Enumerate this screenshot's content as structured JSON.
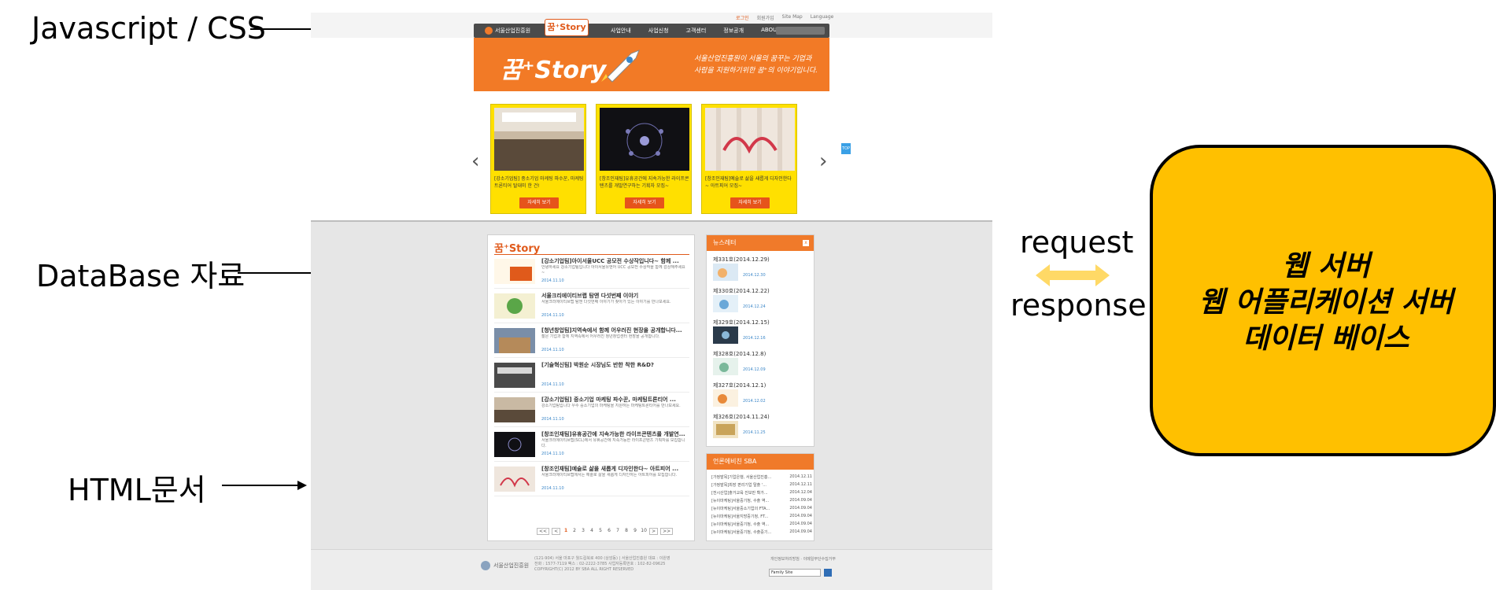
{
  "labels": {
    "javascript_css": "Javascript / CSS",
    "database": "DataBase 자료",
    "html_doc": "HTML문서"
  },
  "connection": {
    "request": "request",
    "response": "response",
    "arrow_color": "#ffd966"
  },
  "server": {
    "line1": "웹 서버",
    "line2": "웹 어플리케이션 서버",
    "line3": "데이터 베이스",
    "fill_color": "#ffc000"
  },
  "site": {
    "util": [
      "로그인",
      "회원가입",
      "Site Map",
      "Language"
    ],
    "gnb": {
      "logo": "서울산업진흥원",
      "story_tab": "꿈⁺Story",
      "menu": [
        "사업안내",
        "사업신청",
        "고객센터",
        "정보공개",
        "ABOUT SBA"
      ]
    },
    "banner": {
      "title": "꿈⁺Story",
      "slogan": "서울산업진흥원이 서울의 꿈꾸는 기업과 사람을 지원하기위한 꿈⁺의 이야기입니다."
    },
    "cards": [
      {
        "caption": "[강소기업팀] 중소기업 마케팅 파수꾼, 마케팅 트론티어 탈대미 한 건!",
        "more": "자세히 보기"
      },
      {
        "caption": "[창조인재팀]유휴공간에 지속가능한 라이프콘텐츠를 개발연구하는 기획자 모집~",
        "more": "자세히 보기"
      },
      {
        "caption": "[창조인재팀]예술로 삶을 새롭게 디자인한다~ 아트피어 모집~",
        "more": "자세히 보기"
      }
    ],
    "top_btn": "TOP",
    "main_panel": {
      "title": "꿈⁺Story",
      "items": [
        {
          "title": "[강소기업팀]아이서울UCC 공모전 수상작입니다~ 함께 ...",
          "desc": "안녕하세요 강소기업팀입니다 아이서울유앤어 UCC 공모전 수상작을 함께 감상해주세요~",
          "date": "2014.11.10"
        },
        {
          "title": "서울크리에이티브랩 탐앤 다섯번째 이야기",
          "desc": "서울크리에이티브랩 탐앤 다섯번째 이야기가 찾아가 있는 이야기를 만나보세요.",
          "date": "2014.11.10"
        },
        {
          "title": "[청년창업팀]지역속에서 함께 어우러진 현장을 공개합니다...",
          "desc": "젊은 기업과 함께 지역속에서 어우러진 청년창업센터 현장을 공개합니다.",
          "date": "2014.11.10"
        },
        {
          "title": "[기술혁신팀] 박원순 시장님도 반한 착한 R&D?",
          "desc": "",
          "date": "2014.11.10"
        },
        {
          "title": "[강소기업팀] 중소기업 마케팅 파수꾼, 마케팅트론티어 ...",
          "desc": "강소기업팀입니다 우수 중소기업의 마케팅을 지원하는 마케팅트론티어를 만나보세요.",
          "date": "2014.11.10"
        },
        {
          "title": "[창조인재팀]유휴공간에 지속가능한 라이프콘텐츠를 개발연...",
          "desc": "서울크리에이티브랩(SCL)에서 유휴공간에 지속가능한 라이프콘텐츠 기획자를 모집합니다.",
          "date": "2014.11.10"
        },
        {
          "title": "[창조인재팀]예술로 삶을 새롭게 디자인한다~ 아트피어 ...",
          "desc": "서울크리에이티브랩에서는 예술로 삶을 새롭게 디자인하는 아트피어를 모집합니다.",
          "date": "2014.11.10"
        }
      ],
      "pager": [
        "<<",
        "<",
        "1",
        "2",
        "3",
        "4",
        "5",
        "6",
        "7",
        "8",
        "9",
        "10",
        ">",
        ">>"
      ]
    },
    "newsletter": {
      "title": "뉴스레터",
      "close": "x",
      "items": [
        {
          "title": "제331호(2014.12.29)",
          "date": "2014.12.30"
        },
        {
          "title": "제330호(2014.12.22)",
          "date": "2014.12.24"
        },
        {
          "title": "제329호(2014.12.15)",
          "date": "2014.12.16"
        },
        {
          "title": "제328호(2014.12.8)",
          "date": "2014.12.09"
        },
        {
          "title": "제327호(2014.12.1)",
          "date": "2014.12.02"
        },
        {
          "title": "제326호(2014.11.24)",
          "date": "2014.11.25"
        }
      ]
    },
    "press": {
      "title": "언론에비친 SBA",
      "items": [
        {
          "t": "[가정발목]기업은행, 서울산업진흥...",
          "d": "2014.12.11"
        },
        {
          "t": "[가정발목]최장 편리기업 탈출 '...",
          "d": "2014.12.11"
        },
        {
          "t": "[전시산업]출거교육 진보만 확가...",
          "d": "2014.12.04"
        },
        {
          "t": "[뉴이마케팅]서울중기청, 수출 역...",
          "d": "2014.09.04"
        },
        {
          "t": "[뉴이마케팅]서울중소기업의 FTA...",
          "d": "2014.09.04"
        },
        {
          "t": "[뉴이마케팅]서울지방중기청, FT...",
          "d": "2014.09.04"
        },
        {
          "t": "[뉴이마케팅]서울중기청, 수출 역...",
          "d": "2014.09.04"
        },
        {
          "t": "[뉴이마케팅]서울중기청, 수출중기...",
          "d": "2014.09.04"
        }
      ]
    },
    "footer": {
      "logo": "서울산업진흥원",
      "address": "(121-904) 서울 마포구 월드컵북로 400 (상암동)  |  서울산업진흥원 대표 : 이원영",
      "contact": "전화 : 1577-7119  팩스 : 02-2222-3785  사업자등록번호 : 102-82-09625",
      "copyright": "COPYRIGHT(C) 2012 BY SBA ALL RIGHT RESERVED",
      "right_links": "개인정보처리방침  ·  이메일무단수집거부",
      "family_select": "Family Site"
    }
  }
}
